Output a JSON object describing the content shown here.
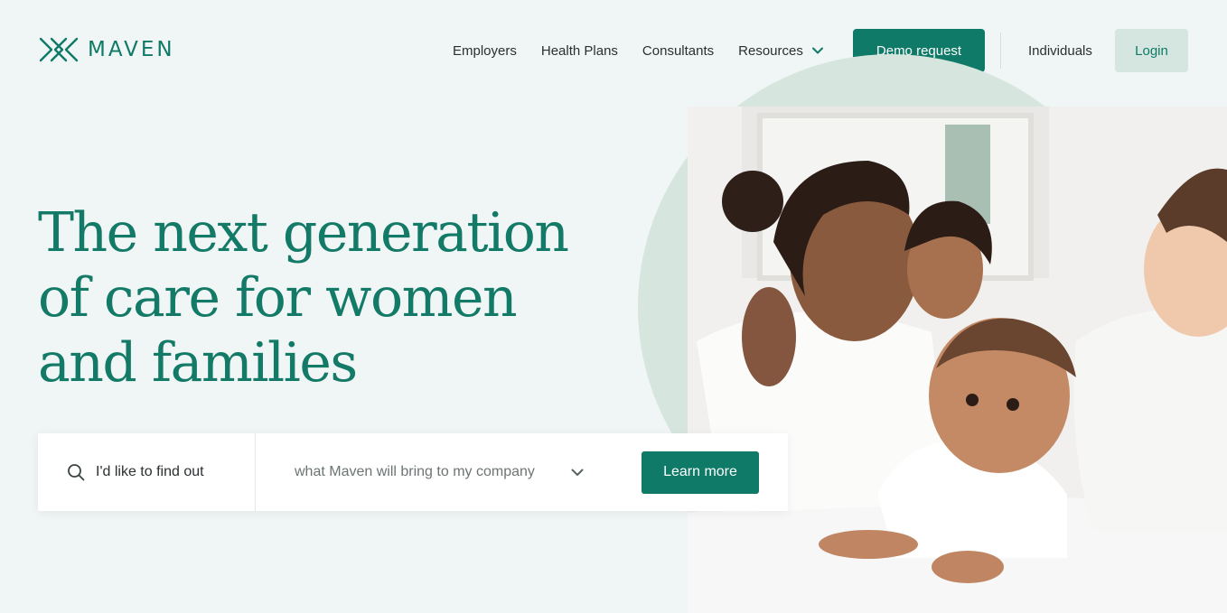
{
  "brand": {
    "name": "MAVEN",
    "logo_icon": "maven-logo-icon",
    "accent": "#0f7a67",
    "accent_soft": "#d4e6df"
  },
  "nav": {
    "items": [
      "Employers",
      "Health Plans",
      "Consultants"
    ],
    "resources_label": "Resources",
    "demo_label": "Demo request",
    "individuals_label": "Individuals",
    "login_label": "Login"
  },
  "hero": {
    "headline_lines": [
      "The next generation",
      "of care for women",
      "and families"
    ]
  },
  "finder": {
    "label": "I'd like to find out",
    "select_value": "what Maven will bring to my company",
    "button_label": "Learn more"
  }
}
